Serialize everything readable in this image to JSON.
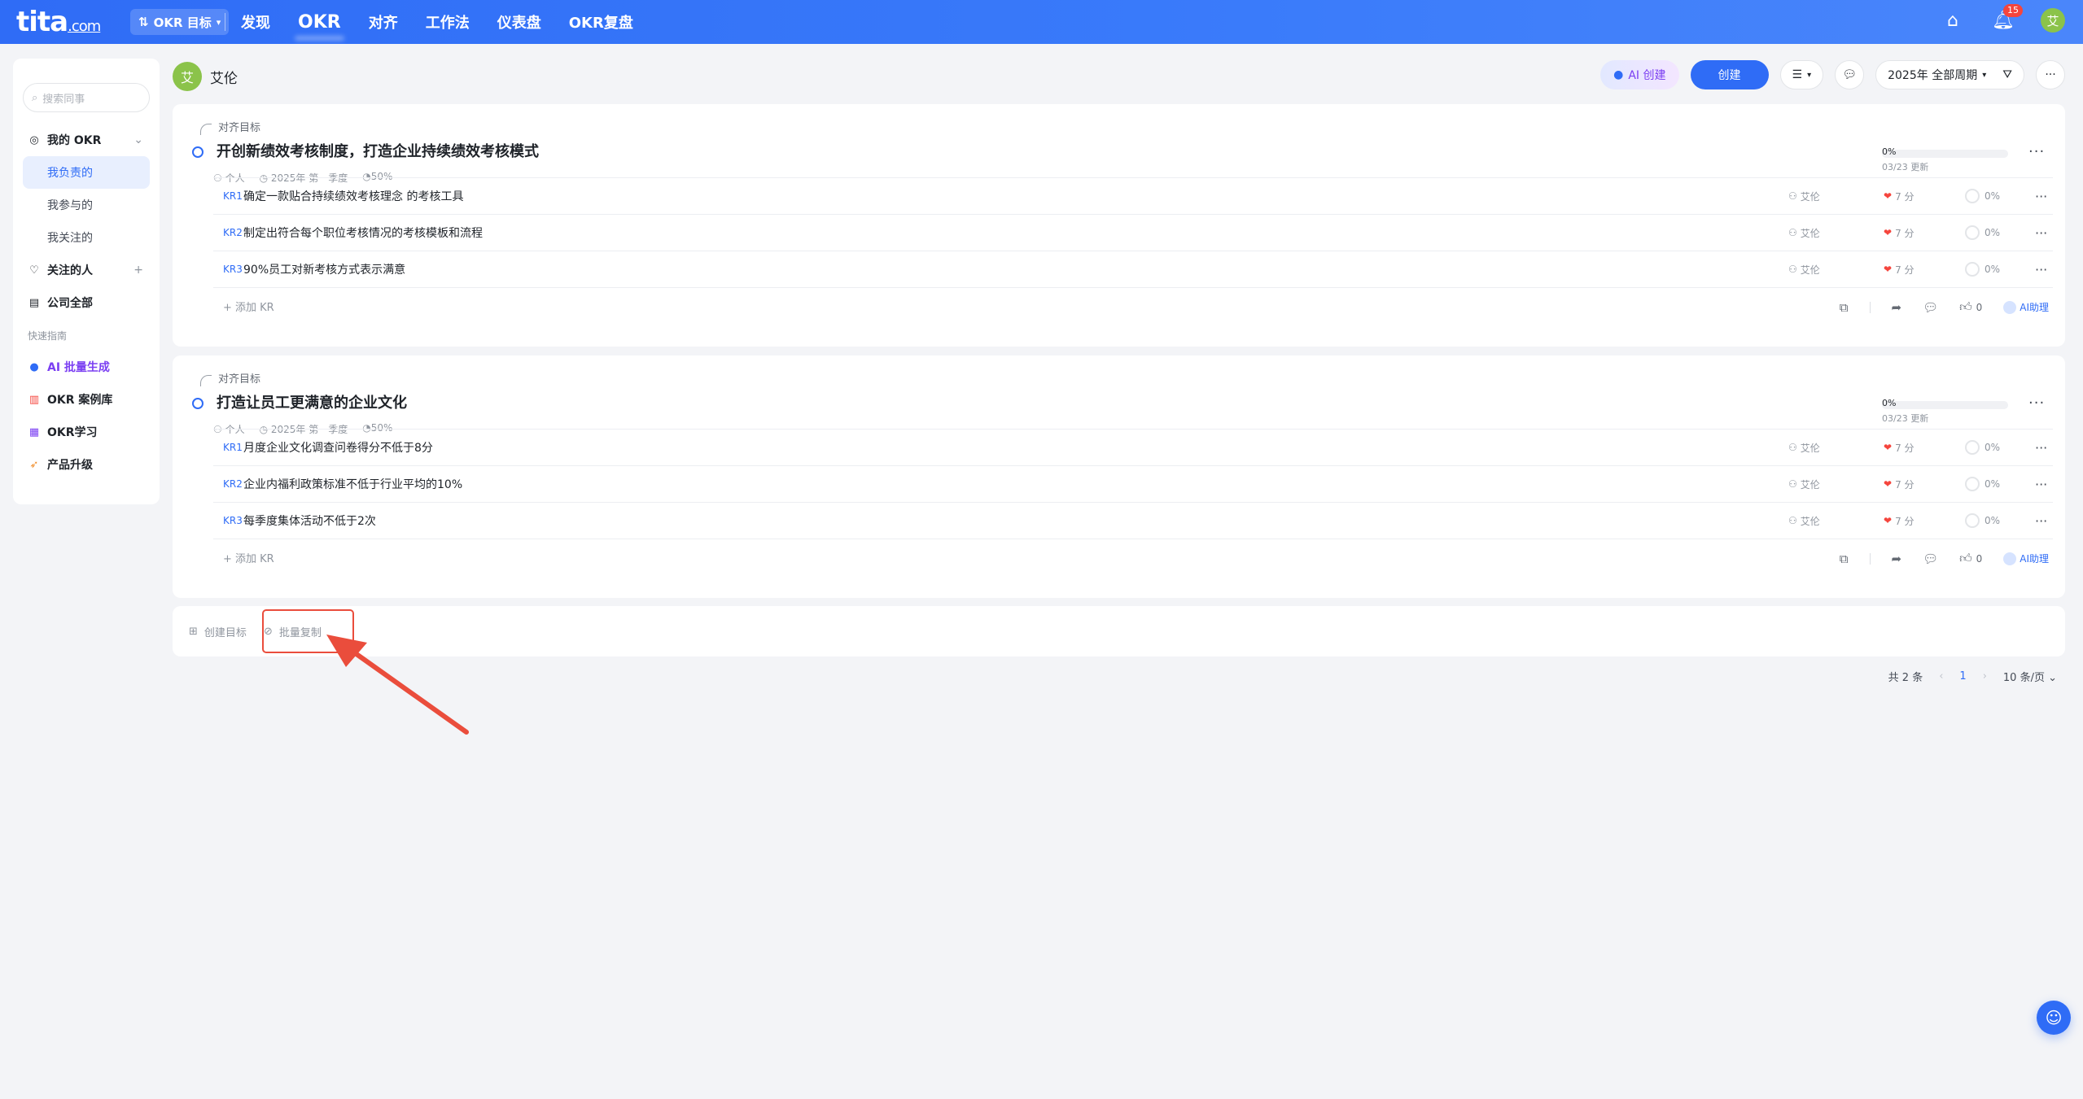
{
  "topbar": {
    "logo_main": "tita",
    "logo_suffix": ".com",
    "okr_switch_label": "OKR 目标",
    "nav": [
      "发现",
      "OKR",
      "对齐",
      "工作法",
      "仪表盘",
      "OKR复盘"
    ],
    "notification_count": "15",
    "avatar_text": "艾"
  },
  "sidebar": {
    "search_placeholder": "搜索同事",
    "my_okr": "我的 OKR",
    "sub_items": [
      "我负责的",
      "我参与的",
      "我关注的"
    ],
    "followed": "关注的人",
    "company": "公司全部",
    "guide_caption": "快速指南",
    "guides": [
      "AI 批量生成",
      "OKR 案例库",
      "OKR学习",
      "产品升级"
    ]
  },
  "header": {
    "user_avatar": "艾",
    "user_name": "艾伦",
    "ai_create": "AI 创建",
    "create": "创建",
    "period": "2025年 全部周期"
  },
  "objectives": [
    {
      "align_label": "对齐目标",
      "title": "开创新绩效考核制度，打造企业持续绩效考核模式",
      "type": "个人",
      "period": "2025年 第一季度",
      "weight": "50%",
      "progress_text": "0%",
      "progress": 0,
      "updated": "03/23 更新",
      "krs": [
        {
          "code": "KR1",
          "text": "确定一款贴合持续绩效考核理念 的考核工具",
          "owner": "艾伦",
          "score": "7 分",
          "progress": "0%"
        },
        {
          "code": "KR2",
          "text": "制定出符合每个职位考核情况的考核模板和流程",
          "owner": "艾伦",
          "score": "7 分",
          "progress": "0%"
        },
        {
          "code": "KR3",
          "text": "90%员工对新考核方式表示满意",
          "owner": "艾伦",
          "score": "7 分",
          "progress": "0%"
        }
      ],
      "add_kr": "+ 添加 KR",
      "likes": "0",
      "ai_assist": "AI助理"
    },
    {
      "align_label": "对齐目标",
      "title": "打造让员工更满意的企业文化",
      "type": "个人",
      "period": "2025年 第一季度",
      "weight": "50%",
      "progress_text": "0%",
      "progress": 0,
      "updated": "03/23 更新",
      "krs": [
        {
          "code": "KR1",
          "text": "月度企业文化调查问卷得分不低于8分",
          "owner": "艾伦",
          "score": "7 分",
          "progress": "0%"
        },
        {
          "code": "KR2",
          "text": "企业内福利政策标准不低于行业平均的10%",
          "owner": "艾伦",
          "score": "7 分",
          "progress": "0%"
        },
        {
          "code": "KR3",
          "text": "每季度集体活动不低于2次",
          "owner": "艾伦",
          "score": "7 分",
          "progress": "0%"
        }
      ],
      "add_kr": "+ 添加 KR",
      "likes": "0",
      "ai_assist": "AI助理"
    }
  ],
  "bottom": {
    "create_goal": "创建目标",
    "batch_copy": "批量复制"
  },
  "pagination": {
    "total": "共 2 条",
    "current": "1",
    "page_size": "10 条/页"
  },
  "colors": {
    "primary": "#2f6cf6",
    "highlight": "#ea4d3c",
    "ai": "#7b3ff2"
  }
}
